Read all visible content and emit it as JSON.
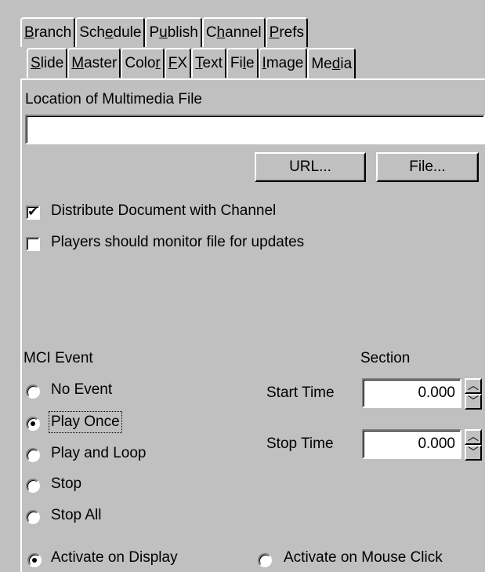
{
  "tabs_top": [
    {
      "text": "Branch",
      "underline": 0
    },
    {
      "text": "Schedule",
      "underline": 3
    },
    {
      "text": "Publish",
      "underline": 1
    },
    {
      "text": "Channel",
      "underline": 1
    },
    {
      "text": "Prefs",
      "underline": 0
    }
  ],
  "tabs_sub": [
    {
      "text": "Slide",
      "underline": 0
    },
    {
      "text": "Master",
      "underline": 0
    },
    {
      "text": "Color",
      "underline": 4
    },
    {
      "text": "FX",
      "underline": 0
    },
    {
      "text": "Text",
      "underline": 0
    },
    {
      "text": "File",
      "underline": 2
    },
    {
      "text": "Image",
      "underline": 0
    },
    {
      "text": "Media",
      "underline": 2,
      "active": true
    }
  ],
  "media": {
    "location_label": "Location of Multimedia File",
    "location_value": "",
    "url_button": "URL...",
    "file_button": "File...",
    "distribute_label": "Distribute Document with Channel",
    "distribute_checked": true,
    "monitor_label": "Players should monitor file for updates",
    "monitor_checked": false
  },
  "mci": {
    "event_label": "MCI Event",
    "section_label": "Section",
    "options": [
      {
        "label": "No Event",
        "checked": false
      },
      {
        "label": "Play Once",
        "checked": true
      },
      {
        "label": "Play and Loop",
        "checked": false
      },
      {
        "label": "Stop",
        "checked": false
      },
      {
        "label": "Stop All",
        "checked": false
      }
    ],
    "start_label": "Start Time",
    "start_value": "0.000",
    "stop_label": "Stop Time",
    "stop_value": "0.000"
  },
  "activation": {
    "display_label": "Activate on Display",
    "display_checked": true,
    "click_label": "Activate on Mouse Click",
    "click_checked": false
  },
  "icons": {
    "check": "✔",
    "spin_up": "︿",
    "spin_down": "﹀"
  }
}
